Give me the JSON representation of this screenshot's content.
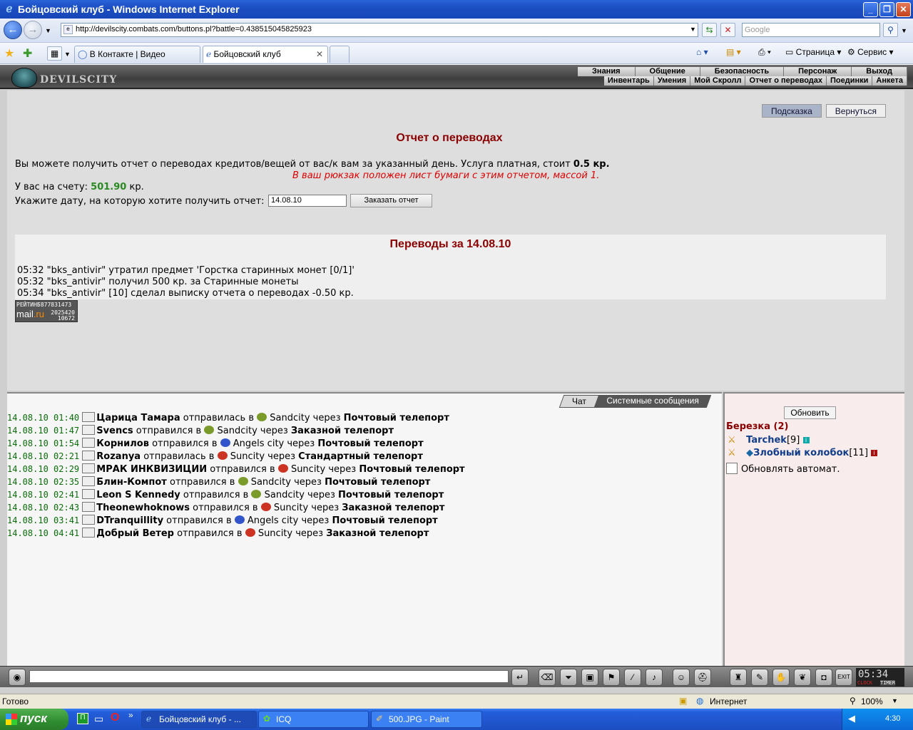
{
  "window": {
    "title": "Бойцовский клуб - Windows Internet Explorer"
  },
  "address": {
    "url": "http://devilscity.combats.com/buttons.pl?battle=0.438515045825923",
    "search_placeholder": "Google"
  },
  "tabs": [
    {
      "label": "В Контакте | Видео"
    },
    {
      "label": "Бойцовский клуб"
    }
  ],
  "commands": {
    "page": "Страница",
    "tools": "Сервис"
  },
  "game": {
    "logo_text": "DEVILSCITY",
    "menu_top": [
      "Знания",
      "Общение",
      "Безопасность",
      "Персонаж",
      "Выход"
    ],
    "menu_sub": [
      "Инвентарь",
      "Умения",
      "Мой Скролл",
      "Отчет о переводах",
      "Поединки",
      "Анкета"
    ]
  },
  "report": {
    "hint_button": "Подсказка",
    "return_button": "Вернуться",
    "title": "Отчет о переводах",
    "description": "Вы можете получить отчет о переводах кредитов/вещей от вас/к вам за указанный день. Услуга платная, стоит ",
    "price": "0.5 кр.",
    "note": "В ваш рюкзак положен лист бумаги с этим отчетом, массой 1.",
    "balance_label": "У вас на счету: ",
    "balance_value": "501.90",
    "balance_unit": " кр.",
    "date_label": "Укажите дату, на которую хотите получить отчет:",
    "date_value": "14.08.10",
    "order_button": "Заказать отчет",
    "transfers_title": "Переводы за 14.08.10",
    "transfers": [
      "05:32 \"bks_antivir\" утратил предмет 'Горстка старинных монет [0/1]'",
      "05:32 \"bks_antivir\" получил 500 кр. за Старинные монеты",
      "05:34 \"bks_antivir\" [10] сделал выписку отчета о переводах -0.50 кр."
    ]
  },
  "counter": {
    "label": "РЕЙТИНГ",
    "brand": "mail",
    "brand_tld": ".ru",
    "n1": "5877831473",
    "n2": "2025420",
    "n3": "10672"
  },
  "chat": {
    "tab_chat": "Чат",
    "tab_system": "Системные сообщения",
    "messages": [
      {
        "time": "14.08.10 01:40",
        "name": "Царица Тамара",
        "verb": " отправилась в ",
        "city": "Sandcity",
        "via": " через ",
        "method": "Почтовый телепорт",
        "color": "#7a9a2a"
      },
      {
        "time": "14.08.10 01:47",
        "name": "Svencs",
        "verb": " отправился в ",
        "city": "Sandcity",
        "via": " через ",
        "method": "Заказной телепорт",
        "color": "#7a9a2a"
      },
      {
        "time": "14.08.10 01:54",
        "name": "Корнилов",
        "verb": " отправился в ",
        "city": "Angels city",
        "via": " через ",
        "method": "Почтовый телепорт",
        "color": "#3355cc"
      },
      {
        "time": "14.08.10 02:21",
        "name": "Rozanya",
        "verb": " отправилась в ",
        "city": "Suncity",
        "via": " через ",
        "method": "Стандартный телепорт",
        "color": "#cc3322"
      },
      {
        "time": "14.08.10 02:29",
        "name": "МРАК ИНКВИЗИЦИИ",
        "verb": " отправился в ",
        "city": "Suncity",
        "via": " через ",
        "method": "Почтовый телепорт",
        "color": "#cc3322"
      },
      {
        "time": "14.08.10 02:35",
        "name": "Блин-Компот",
        "verb": " отправился в ",
        "city": "Sandcity",
        "via": " через ",
        "method": "Почтовый телепорт",
        "color": "#7a9a2a"
      },
      {
        "time": "14.08.10 02:41",
        "name": "Leon S Kennedy",
        "verb": " отправился в ",
        "city": "Sandcity",
        "via": " через ",
        "method": "Почтовый телепорт",
        "color": "#7a9a2a"
      },
      {
        "time": "14.08.10 02:43",
        "name": "Theonewhoknows",
        "verb": " отправился в ",
        "city": "Suncity",
        "via": " через ",
        "method": "Заказной телепорт",
        "color": "#cc3322"
      },
      {
        "time": "14.08.10 03:41",
        "name": "DTranquillity",
        "verb": " отправился в ",
        "city": "Angels city",
        "via": " через ",
        "method": "Почтовый телепорт",
        "color": "#3355cc"
      },
      {
        "time": "14.08.10 04:41",
        "name": "Добрый Ветер",
        "verb": " отправился в ",
        "city": "Suncity",
        "via": " через ",
        "method": "Заказной телепорт",
        "color": "#cc3322"
      }
    ]
  },
  "online": {
    "refresh_button": "Обновить",
    "room": "Березка (2)",
    "users": [
      {
        "name": "Tarchek",
        "level": "[9]"
      },
      {
        "name": "Злобный колобок",
        "level": "[11]"
      }
    ],
    "auto_refresh": "Обновлять автомат."
  },
  "clock": {
    "time": "05:34",
    "label_clock": "CLOCK",
    "label_timer": "TIMER"
  },
  "statusbar": {
    "text": "Готово",
    "zone": "Интернет",
    "zoom": "100%"
  },
  "taskbar": {
    "start": "пуск",
    "tasks": [
      "Бойцовский клуб - ...",
      "ICQ",
      "500.JPG - Paint"
    ],
    "lang": "RU",
    "time": "4:30"
  }
}
